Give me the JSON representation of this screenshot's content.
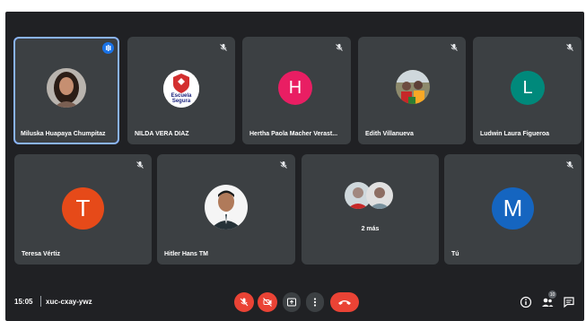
{
  "meeting": {
    "time": "15:05",
    "code": "xuc-cxay-ywz"
  },
  "participants": [
    {
      "name": "Miluska Huapaya Chumpitaz",
      "kind": "photo",
      "speaking": true
    },
    {
      "name": "NILDA VERA DIAZ",
      "kind": "logo",
      "logo_text": "Escuela Segura",
      "muted": true
    },
    {
      "name": "Hertha Paola Macher Verast...",
      "kind": "initial",
      "initial": "H",
      "color": "#e91e63",
      "muted": true
    },
    {
      "name": "Edith Villanueva",
      "kind": "photo",
      "muted": true
    },
    {
      "name": "Ludwin Laura Figueroa",
      "kind": "initial",
      "initial": "L",
      "color": "#00897b",
      "muted": true
    },
    {
      "name": "Teresa Vértiz",
      "kind": "initial",
      "initial": "T",
      "color": "#e64a19",
      "muted": true
    },
    {
      "name": "Hitler Hans TM",
      "kind": "photo",
      "muted": true
    },
    {
      "name": "2 más",
      "kind": "group"
    },
    {
      "name": "Tú",
      "kind": "initial",
      "initial": "M",
      "color": "#1565c0",
      "muted": true
    }
  ],
  "controls": {
    "people_count": "10",
    "icons": [
      "mic-off-icon",
      "camera-off-icon",
      "present-icon",
      "more-icon",
      "hang-up-icon",
      "info-icon",
      "people-icon",
      "chat-icon"
    ]
  }
}
